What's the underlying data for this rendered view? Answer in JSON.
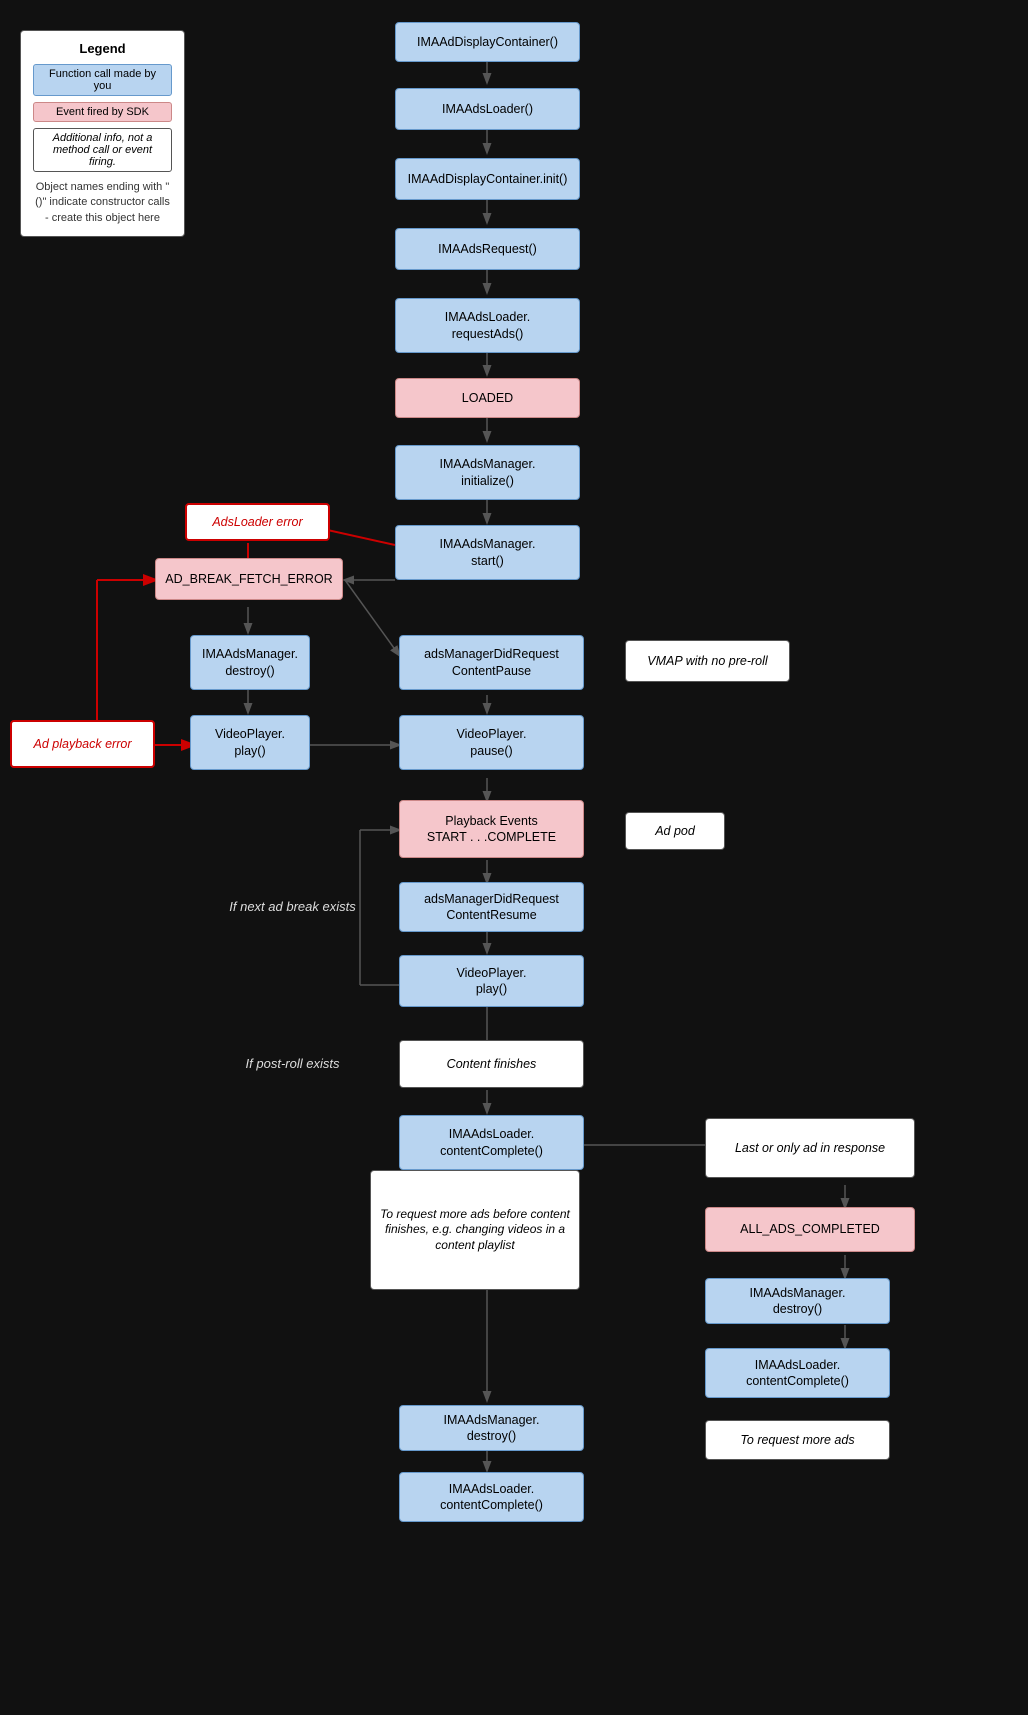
{
  "legend": {
    "title": "Legend",
    "item1": "Function call made by you",
    "item2": "Event fired by SDK",
    "item3": "Additional info, not a method call or event firing.",
    "note": "Object names ending with \"()\" indicate constructor calls - create this object here"
  },
  "nodes": {
    "ima_display_container": "IMAAd​DisplayContainer()",
    "ima_ads_loader": "IMAAdsLoader()",
    "ima_display_container_init": "IMAAd​DisplayContainer.init()",
    "ima_ads_request": "IMAAdsRequest()",
    "ima_ads_loader_request": "IMAAdsLoader.\nrequestAds()",
    "loaded": "LOADED",
    "ima_ads_manager_init": "IMAAdsManager.\ninitialize()",
    "ima_ads_manager_start": "IMAAdsManager.\nstart()",
    "ads_loader_error": "AdsLoader error",
    "ad_break_fetch_error": "AD_BREAK_FETCH_ERROR",
    "ad_playback_error": "Ad playback error",
    "ima_ads_manager_destroy1": "IMAAdsManager.\ndestroy()",
    "ads_manager_did_request_pause": "adsManagerDidRequest​ContentPause",
    "vmap_no_preroll": "VMAP with no pre-roll",
    "video_player_play1": "VideoPlayer.\nplay()",
    "video_player_pause": "VideoPlayer.\npause()",
    "playback_events": "Playback Events\nSTART . . .COMPLETE",
    "ad_pod": "Ad pod",
    "if_next_ad_break": "If next ad break exists",
    "ads_manager_resume": "adsManagerDidRequest​ContentResume",
    "video_player_play2": "VideoPlayer.\nplay()",
    "if_post_roll": "If post-roll exists",
    "content_finishes": "Content finishes",
    "last_only_ad": "Last or only ad in response",
    "all_ads_completed": "ALL_ADS_COMPLETED",
    "ima_ads_loader_content_complete1": "IMAAdsLoader.\ncontentComplete()",
    "ima_ads_manager_destroy2": "IMAAdsManager.\ndestroy()",
    "ima_ads_loader_content_complete2": "IMAAdsLoader.\ncontentComplete()",
    "to_request_more_ads_note": "To request more ads before content finishes, e.g. changing videos in a content playlist",
    "to_request_more_ads": "To request more ads",
    "ima_ads_manager_destroy3": "IMAAdsManager.\ndestroy()",
    "ima_ads_loader_content_complete3": "IMAAdsLoader.\ncontentComplete()"
  }
}
